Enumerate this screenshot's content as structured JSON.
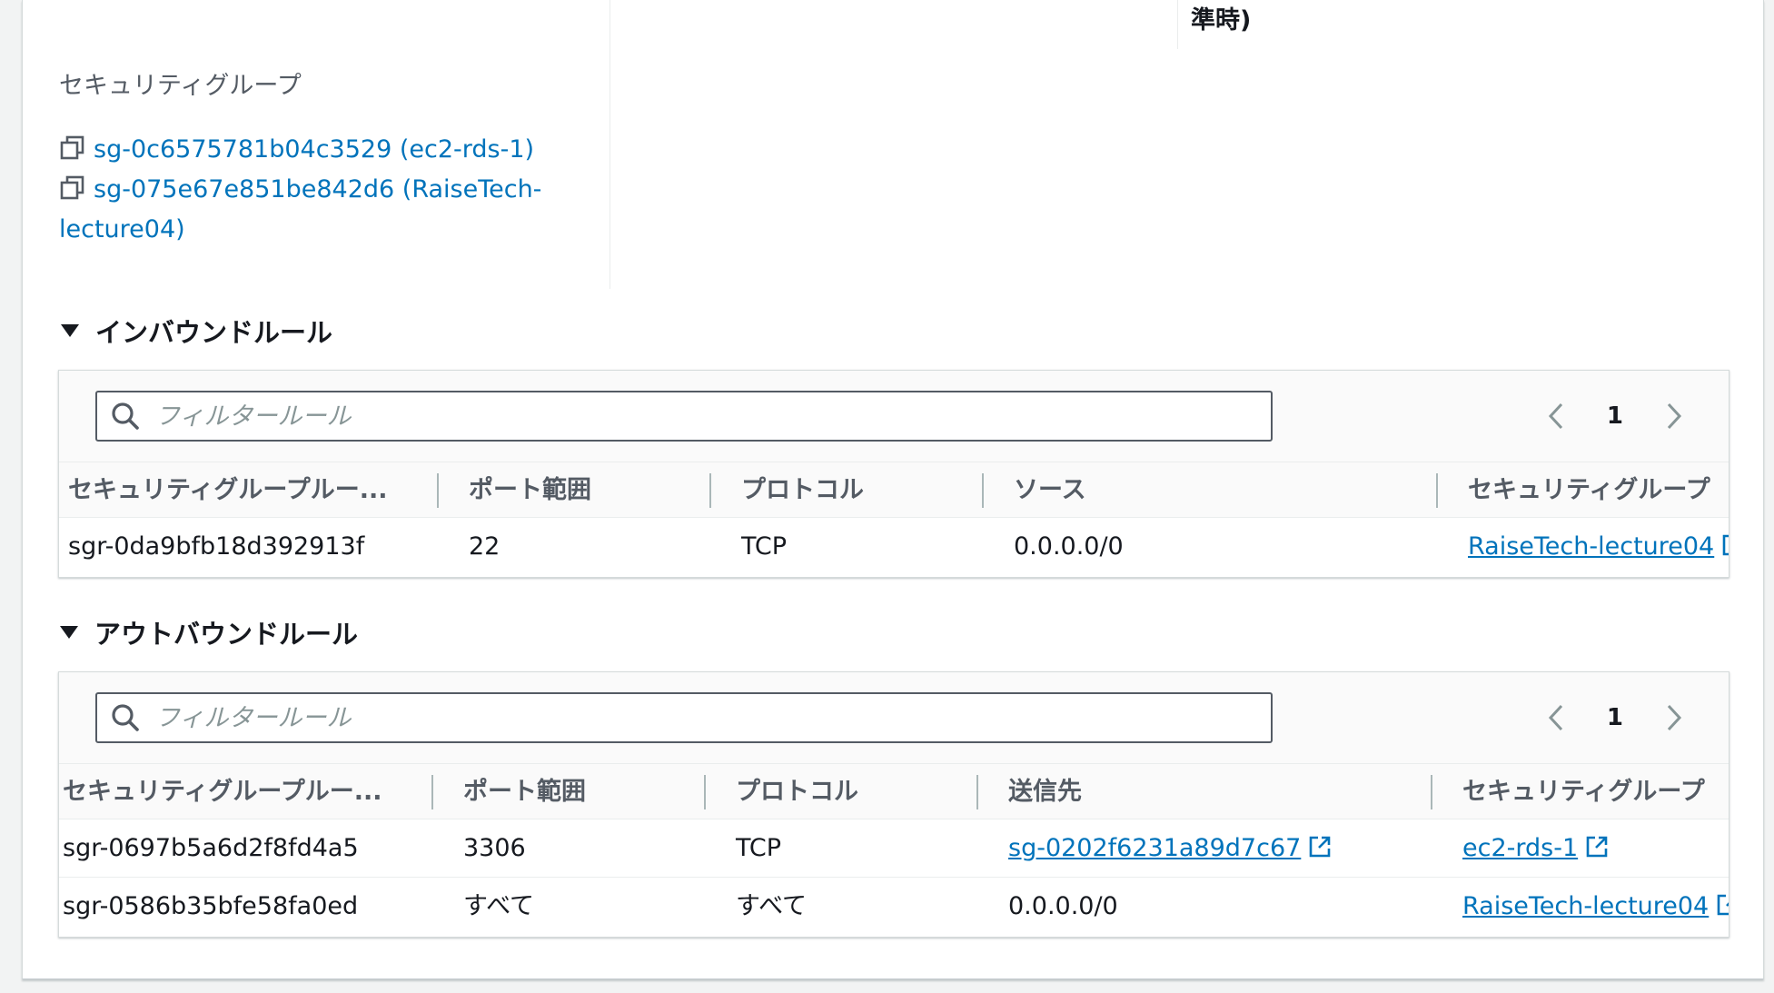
{
  "header": {
    "time_suffix": "準時)"
  },
  "security_groups": {
    "label": "セキュリティグループ",
    "items": [
      {
        "id": "sg-0c6575781b04c3529",
        "name_text": "(ec2-rds-1)",
        "full": "sg-0c6575781b04c3529 (ec2-rds-1)"
      },
      {
        "id": "sg-075e67e851be842d6",
        "full": "sg-075e67e851be842d6 (RaiseTech-lecture04)"
      }
    ]
  },
  "inbound": {
    "title": "インバウンドルール",
    "filter_placeholder": "フィルタールール",
    "page": "1",
    "columns": [
      "セキュリティグループルー...",
      "ポート範囲",
      "プロトコル",
      "ソース",
      "セキュリティグループ"
    ],
    "rows": [
      {
        "rule_id": "sgr-0da9bfb18d392913f",
        "port": "22",
        "protocol": "TCP",
        "source": "0.0.0.0/0",
        "sg": "RaiseTech-lecture04"
      }
    ]
  },
  "outbound": {
    "title": "アウトバウンドルール",
    "filter_placeholder": "フィルタールール",
    "page": "1",
    "columns": [
      "セキュリティグループルー...",
      "ポート範囲",
      "プロトコル",
      "送信先",
      "セキュリティグループ"
    ],
    "rows": [
      {
        "rule_id": "sgr-0697b5a6d2f8fd4a5",
        "port": "3306",
        "protocol": "TCP",
        "dest": "sg-0202f6231a89d7c67",
        "sg": "ec2-rds-1"
      },
      {
        "rule_id": "sgr-0586b35bfe58fa0ed",
        "port": "すべて",
        "protocol": "すべて",
        "dest": "0.0.0.0/0",
        "sg": "RaiseTech-lecture04"
      }
    ]
  },
  "colors": {
    "link": "#0073bb",
    "text": "#16191f",
    "muted": "#545b64"
  },
  "icons": [
    "copy-icon",
    "search-icon",
    "chevron-left-icon",
    "chevron-right-icon",
    "external-link-icon",
    "caret-down-icon"
  ]
}
